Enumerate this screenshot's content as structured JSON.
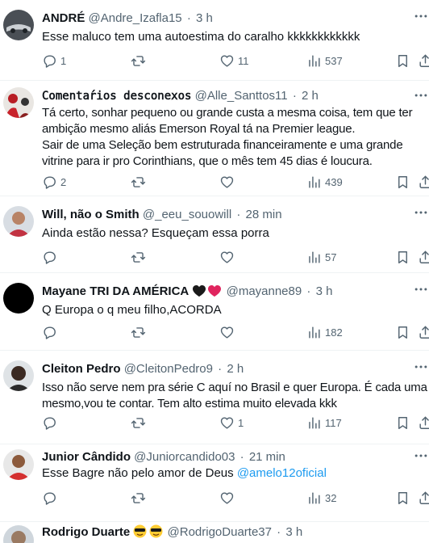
{
  "tweets": [
    {
      "name": "ANDRÉ",
      "handle": "@Andre_Izafla15",
      "time": "3 h",
      "body": "Esse maluco tem uma autoestima do caralho kkkkkkkkkkkk",
      "replies": "1",
      "retweets": "",
      "likes": "11",
      "views": "537"
    },
    {
      "name": "𝙲𝚘𝚖𝚎𝚗𝚝𝚊́𝚛𝚒𝚘𝚜 𝚍𝚎𝚜𝚌𝚘𝚗𝚎𝚡𝚘𝚜",
      "handle": "@Alle_Santtos11",
      "time": "2 h",
      "body": "Tá certo, sonhar pequeno ou grande custa a mesma coisa, tem que ter ambição mesmo aliás Emerson Royal tá na Premier league.\nSair de uma Seleção bem estruturada financeiramente e uma grande vitrine para ir pro Corinthians, que o mês tem 45 dias é loucura.",
      "replies": "2",
      "retweets": "",
      "likes": "",
      "views": "439"
    },
    {
      "name": "Will, não o Smith",
      "handle": "@_eeu_souowill",
      "time": "28 min",
      "body": "Ainda estão nessa? Esqueçam essa porra",
      "replies": "",
      "retweets": "",
      "likes": "",
      "views": "57"
    },
    {
      "name": "Mayane TRI DA AMÉRICA",
      "name_emoji": "🖤❤️",
      "handle": "@mayanne89",
      "time": "3 h",
      "body": "Q Europa o q meu filho,ACORDA",
      "replies": "",
      "retweets": "",
      "likes": "",
      "views": "182"
    },
    {
      "name": "Cleiton Pedro",
      "handle": "@CleitonPedro9",
      "time": "2 h",
      "body": "Isso não serve nem pra série C aquí no Brasil e quer Europa. É cada uma mesmo,vou te contar. Tem alto estima muito elevada kkk",
      "replies": "",
      "retweets": "",
      "likes": "1",
      "views": "117"
    },
    {
      "name": "Junior Cândido",
      "handle": "@Juniorcandido03",
      "time": "21 min",
      "body": "Esse Bagre não pelo amor de Deus ",
      "mention": "@amelo12oficial",
      "replies": "",
      "retweets": "",
      "likes": "",
      "views": "32"
    },
    {
      "name": "Rodrigo Duarte",
      "name_emoji": "😎😎",
      "handle": "@RodrigoDuarte37",
      "time": "3 h"
    }
  ],
  "separator": "·",
  "icons": {
    "reply": "reply-icon",
    "retweet": "retweet-icon",
    "like": "heart-icon",
    "views": "views-icon",
    "bookmark": "bookmark-icon",
    "share": "share-icon",
    "more": "more-icon"
  },
  "colors": {
    "text": "#0f1419",
    "secondary": "#536471",
    "link": "#1d9bf0",
    "divider": "#eff3f4"
  }
}
